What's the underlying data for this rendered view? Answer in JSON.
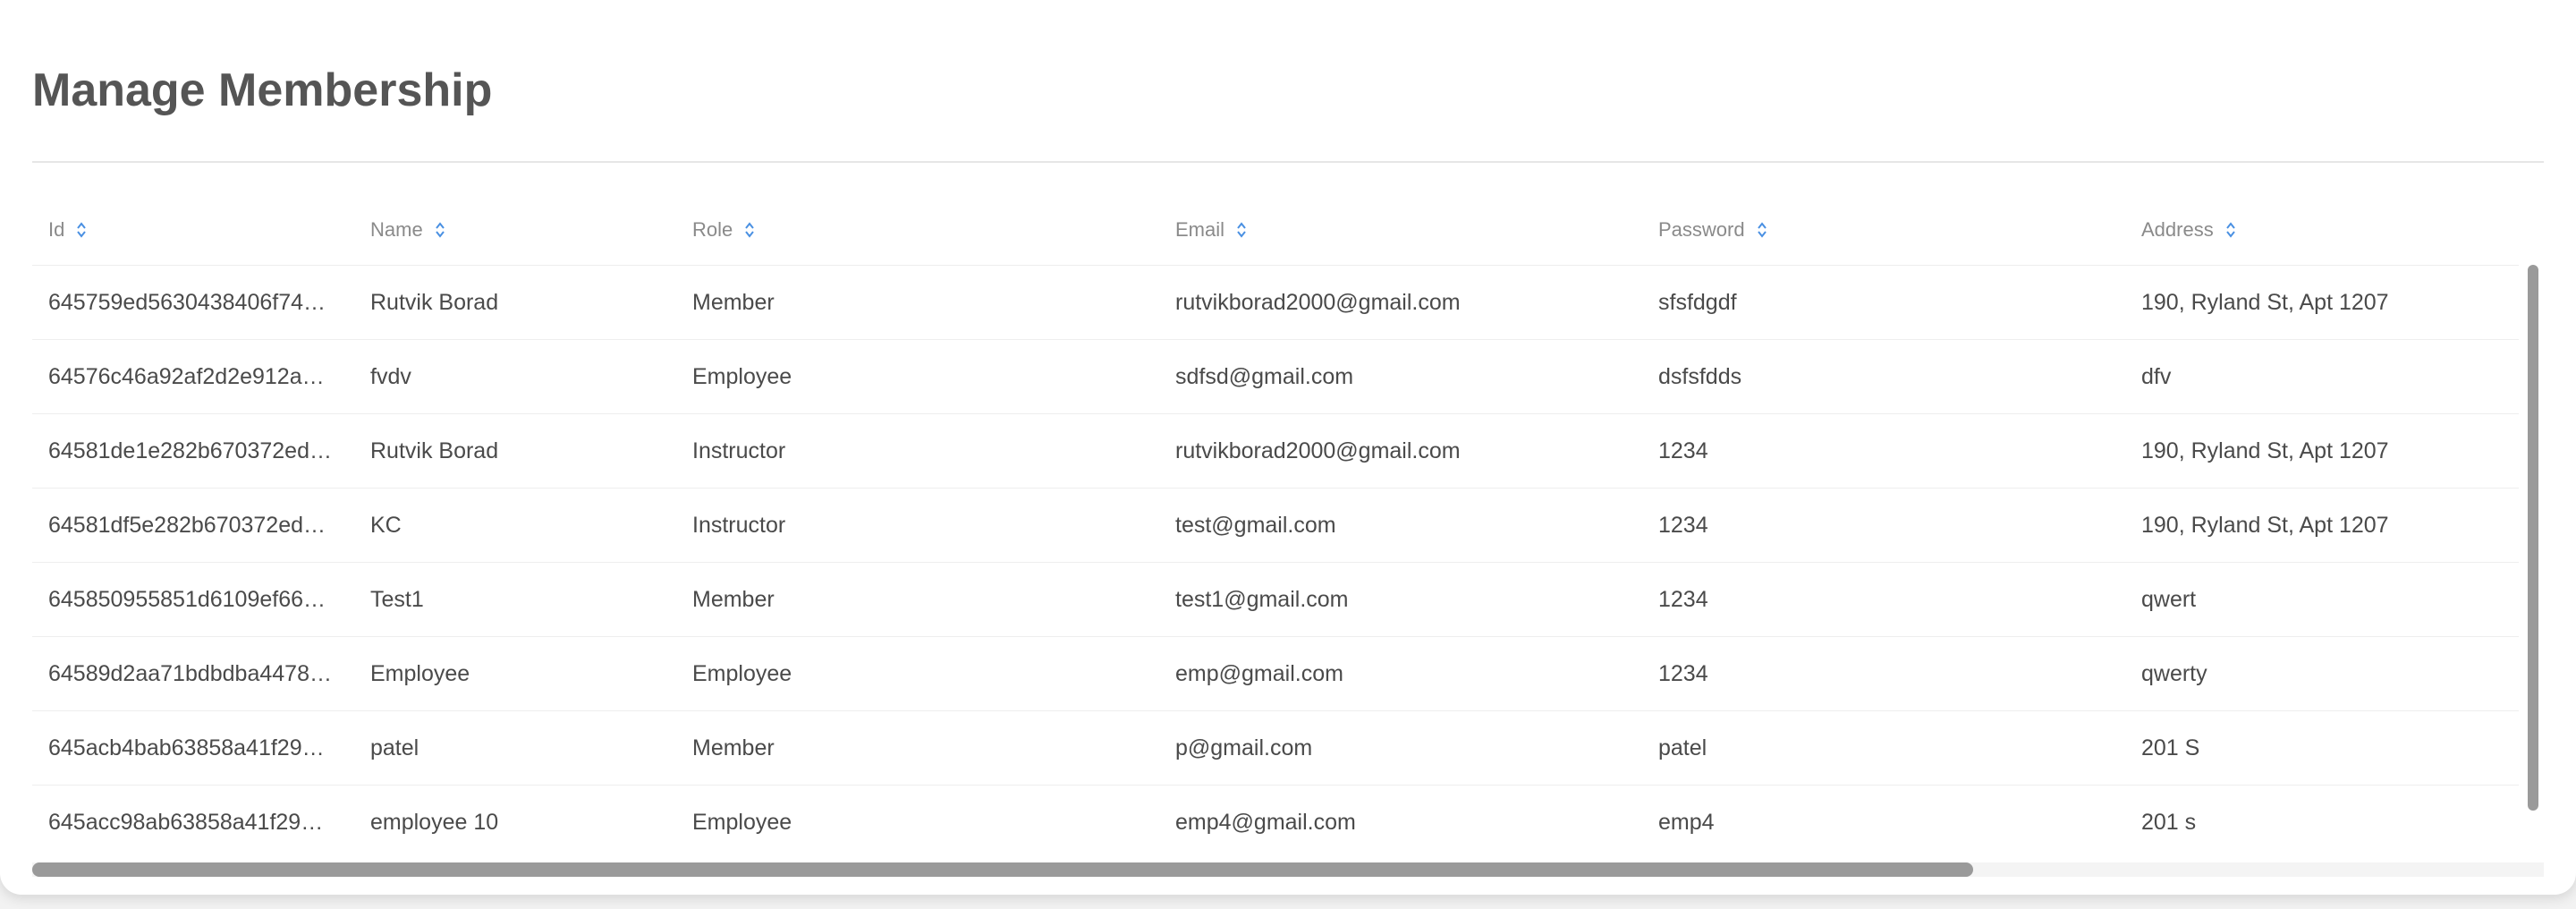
{
  "page": {
    "title": "Manage Membership"
  },
  "table": {
    "columns": [
      "Id",
      "Name",
      "Role",
      "Email",
      "Password",
      "Address"
    ],
    "rows": [
      [
        "645759ed5630438406f74…",
        "Rutvik Borad",
        "Member",
        "rutvikborad2000@gmail.com",
        "sfsfdgdf",
        "190, Ryland St, Apt 1207"
      ],
      [
        "64576c46a92af2d2e912a…",
        "fvdv",
        "Employee",
        "sdfsd@gmail.com",
        "dsfsfdds",
        "dfv"
      ],
      [
        "64581de1e282b670372ed…",
        "Rutvik Borad",
        "Instructor",
        "rutvikborad2000@gmail.com",
        "1234",
        "190, Ryland St, Apt 1207"
      ],
      [
        "64581df5e282b670372ed…",
        "KC",
        "Instructor",
        "test@gmail.com",
        "1234",
        "190, Ryland St, Apt 1207"
      ],
      [
        "645850955851d6109ef66…",
        "Test1",
        "Member",
        "test1@gmail.com",
        "1234",
        "qwert"
      ],
      [
        "64589d2aa71bdbdba4478…",
        "Employee",
        "Employee",
        "emp@gmail.com",
        "1234",
        "qwerty"
      ],
      [
        "645acb4bab63858a41f29…",
        "patel",
        "Member",
        "p@gmail.com",
        "patel",
        "201 S"
      ],
      [
        "645acc98ab63858a41f29…",
        "employee 10",
        "Employee",
        "emp4@gmail.com",
        "emp4",
        "201 s"
      ]
    ]
  },
  "icons": {
    "sort": "sort-icon"
  },
  "colors": {
    "accent": "#4a90e2",
    "title": "#555555",
    "header_text": "#8a8a8a",
    "cell_text": "#4a4a4a"
  }
}
